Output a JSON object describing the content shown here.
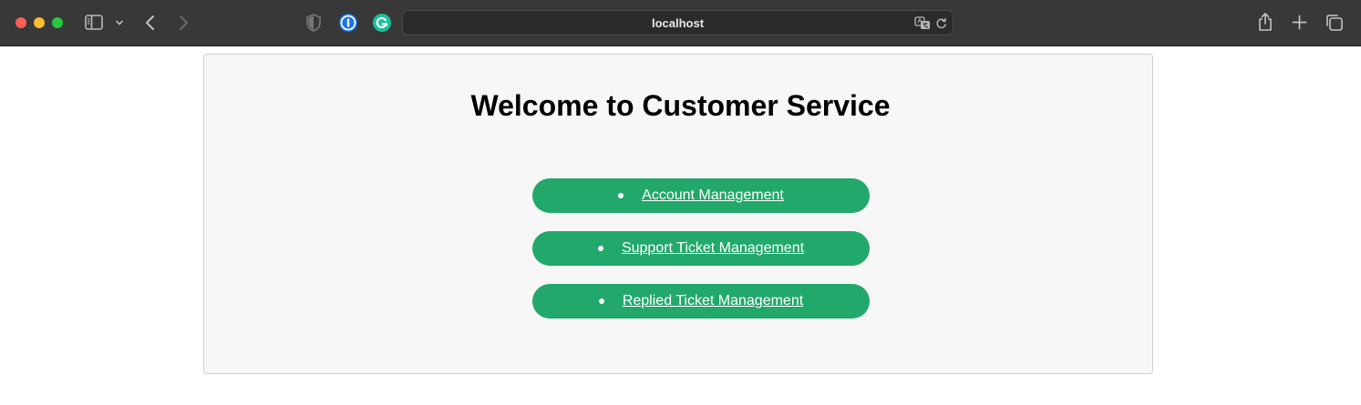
{
  "browser": {
    "url": "localhost"
  },
  "page": {
    "title": "Welcome to Customer Service",
    "accent_color": "#22a86b",
    "menu": [
      {
        "label": "Account Management",
        "icon": "bullet"
      },
      {
        "label": "Support Ticket Management",
        "icon": "bullet"
      },
      {
        "label": "Replied Ticket Management",
        "icon": "bullet"
      }
    ]
  },
  "icons": {
    "toolbar": [
      "sidebar-icon",
      "chevron-down-icon",
      "back-icon",
      "forward-icon",
      "shield-icon",
      "password-manager-icon",
      "grammarly-icon",
      "translate-icon",
      "reload-icon",
      "share-icon",
      "plus-icon",
      "tabs-icon"
    ]
  }
}
